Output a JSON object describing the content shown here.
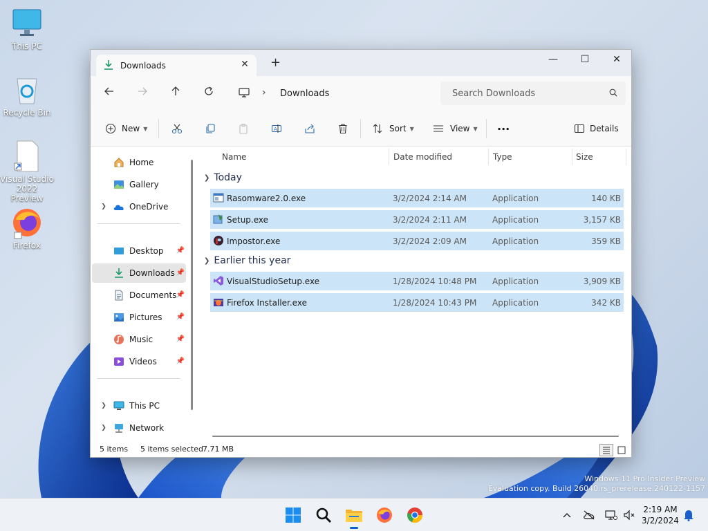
{
  "desktop": {
    "icons": [
      {
        "label": "This PC",
        "icon": "monitor-icon"
      },
      {
        "label": "Recycle Bin",
        "icon": "recycle-bin-icon"
      },
      {
        "label": "Visual Studio 2022 Preview",
        "icon": "shortcut-file-icon"
      },
      {
        "label": "Firefox",
        "icon": "firefox-icon"
      }
    ]
  },
  "window": {
    "tab_title": "Downloads",
    "tab_close": "✕",
    "new_tab": "+",
    "controls": {
      "minimize": "—",
      "maximize": "☐",
      "close": "✕"
    },
    "address": {
      "crumb": "Downloads",
      "separator": "›",
      "search_placeholder": "Search Downloads"
    },
    "commands": {
      "new_label": "New",
      "sort_label": "Sort",
      "view_label": "View",
      "more_label": "···",
      "details_label": "Details"
    },
    "nav": {
      "items": [
        {
          "label": "Home",
          "icon": "home-icon"
        },
        {
          "label": "Gallery",
          "icon": "gallery-icon"
        },
        {
          "label": "OneDrive",
          "icon": "cloud-icon"
        },
        {
          "label": "Desktop",
          "icon": "desktop-icon"
        },
        {
          "label": "Downloads",
          "icon": "download-icon"
        },
        {
          "label": "Documents",
          "icon": "document-icon"
        },
        {
          "label": "Pictures",
          "icon": "pictures-icon"
        },
        {
          "label": "Music",
          "icon": "music-icon"
        },
        {
          "label": "Videos",
          "icon": "videos-icon"
        },
        {
          "label": "This PC",
          "icon": "monitor-icon"
        },
        {
          "label": "Network",
          "icon": "network-icon"
        }
      ]
    },
    "columns": {
      "name": "Name",
      "date": "Date modified",
      "type": "Type",
      "size": "Size"
    },
    "groups": [
      {
        "label": "Today",
        "files": [
          {
            "name": "Rasomware2.0.exe",
            "date": "3/2/2024 2:14 AM",
            "type": "Application",
            "size": "140 KB"
          },
          {
            "name": "Setup.exe",
            "date": "3/2/2024 2:11 AM",
            "type": "Application",
            "size": "3,157 KB"
          },
          {
            "name": "Impostor.exe",
            "date": "3/2/2024 2:09 AM",
            "type": "Application",
            "size": "359 KB"
          }
        ]
      },
      {
        "label": "Earlier this year",
        "files": [
          {
            "name": "VisualStudioSetup.exe",
            "date": "1/28/2024 10:48 PM",
            "type": "Application",
            "size": "3,909 KB"
          },
          {
            "name": "Firefox Installer.exe",
            "date": "1/28/2024 10:43 PM",
            "type": "Application",
            "size": "342 KB"
          }
        ]
      }
    ],
    "status": {
      "count": "5 items",
      "selected": "5 items selected",
      "size": "7.71 MB"
    }
  },
  "watermark": {
    "line1": "Windows 11 Pro Insider Preview",
    "line2": "Evaluation copy. Build 26040.rs_prerelease.240122-1157"
  },
  "taskbar": {
    "time": "2:19 AM",
    "date": "3/2/2024"
  },
  "colors": {
    "selection": "#cce4f7",
    "accent": "#0a64c8",
    "wallpaper": "#c9d8ea"
  }
}
